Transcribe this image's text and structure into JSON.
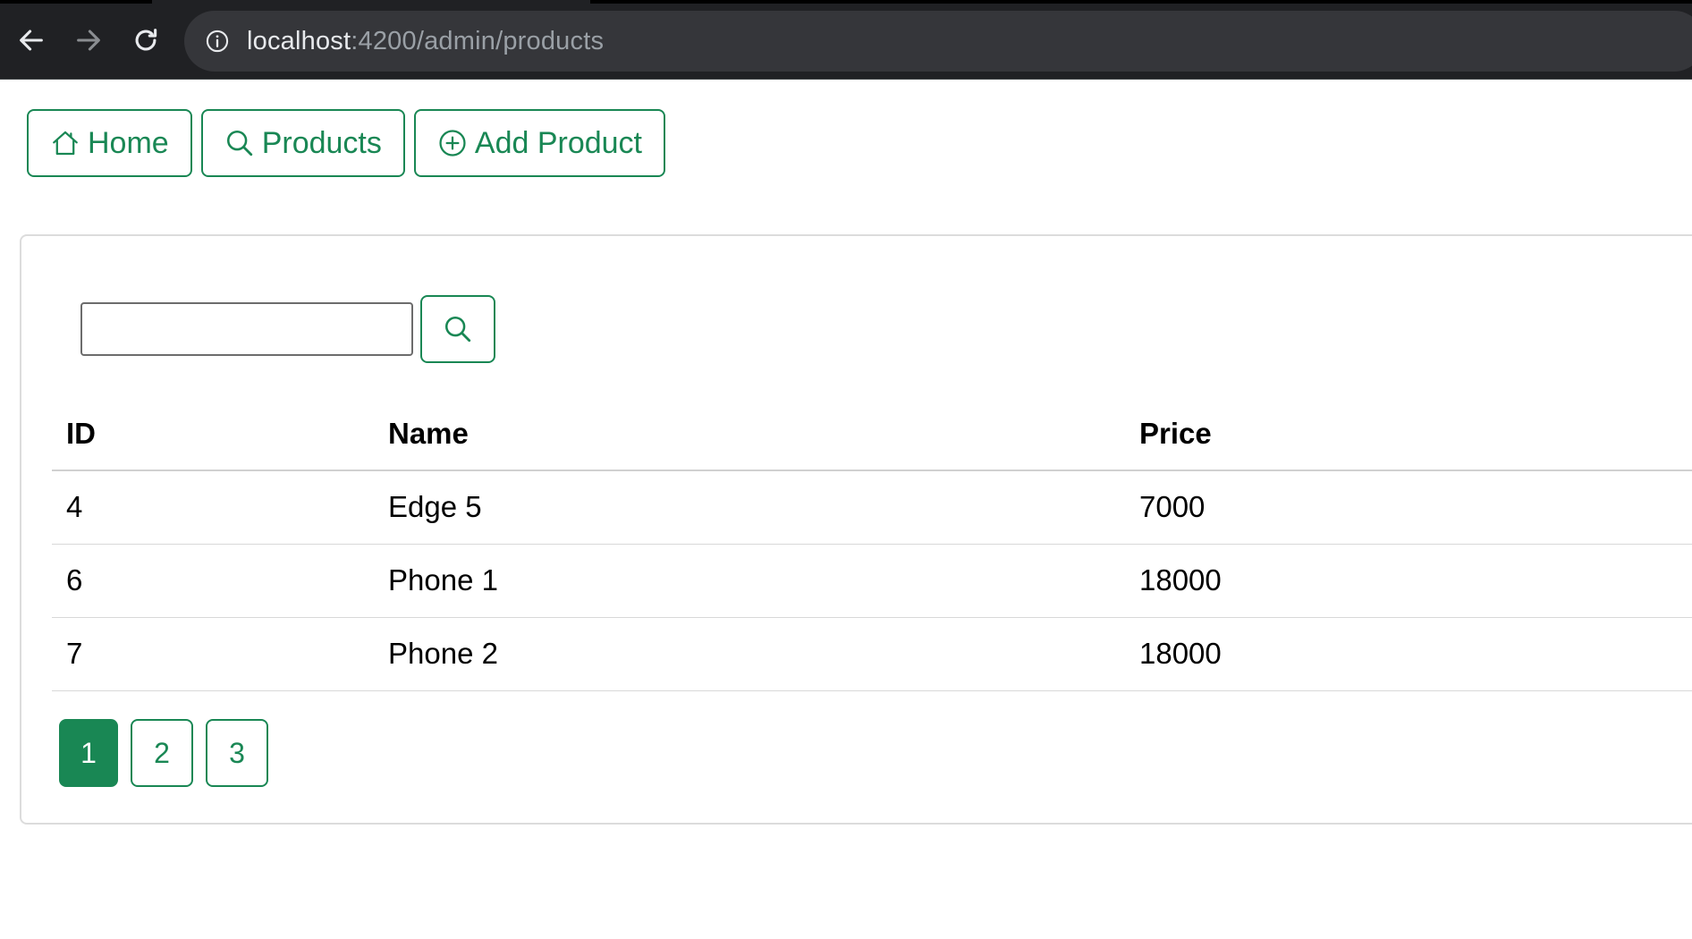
{
  "browser": {
    "url_host": "localhost",
    "url_rest": ":4200/admin/products"
  },
  "nav": {
    "home_label": "Home",
    "products_label": "Products",
    "add_product_label": "Add Product"
  },
  "search": {
    "value": "",
    "placeholder": ""
  },
  "table": {
    "headers": [
      "ID",
      "Name",
      "Price"
    ],
    "rows": [
      {
        "id": "4",
        "name": "Edge 5",
        "price": "7000"
      },
      {
        "id": "6",
        "name": "Phone 1",
        "price": "18000"
      },
      {
        "id": "7",
        "name": "Phone 2",
        "price": "18000"
      }
    ]
  },
  "pagination": {
    "pages": [
      "1",
      "2",
      "3"
    ],
    "active": "1"
  },
  "colors": {
    "accent": "#198754",
    "chrome_bg": "#202124"
  }
}
